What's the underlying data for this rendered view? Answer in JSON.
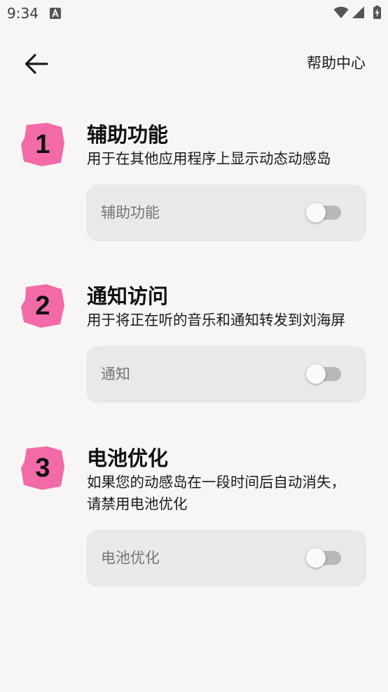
{
  "status_bar": {
    "time": "9:34",
    "icons": [
      "app-notification-icon",
      "wifi-icon",
      "cellular-signal-icon",
      "battery-charging-icon"
    ]
  },
  "app_bar": {
    "back_icon": "back-arrow-icon",
    "help_label": "帮助中心"
  },
  "steps": [
    {
      "number": "1",
      "title": "辅助功能",
      "description_lines": [
        "用于在其他应用程序上显示动态动感岛"
      ],
      "setting_label": "辅助功能",
      "enabled": false
    },
    {
      "number": "2",
      "title": "通知访问",
      "description_lines": [
        "用于将正在听的音乐和通知转发到刘海屏"
      ],
      "setting_label": "通知",
      "enabled": false
    },
    {
      "number": "3",
      "title": "电池优化",
      "description_lines": [
        "如果您的动感岛在一段时间后自动消失，",
        "请禁用电池优化"
      ],
      "setting_label": "电池优化",
      "enabled": false
    }
  ],
  "colors": {
    "background": "#f7f6f4",
    "accent_pink": "#f36aa8",
    "card": "#eae9e7",
    "toggle_track": "#b8b8b8"
  }
}
